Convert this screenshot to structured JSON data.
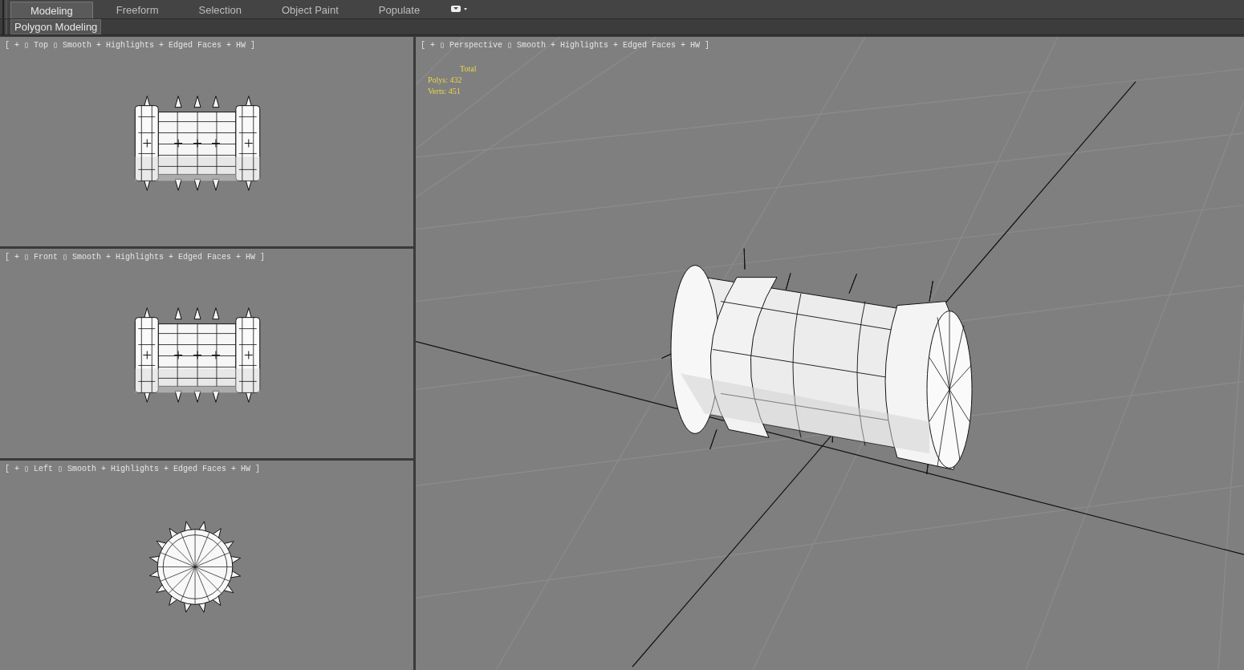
{
  "ribbon_tabs": [
    {
      "label": "Modeling",
      "selected": true
    },
    {
      "label": "Freeform",
      "selected": false
    },
    {
      "label": "Selection",
      "selected": false
    },
    {
      "label": "Object Paint",
      "selected": false
    },
    {
      "label": "Populate",
      "selected": false
    }
  ],
  "panel": {
    "label": "Polygon Modeling"
  },
  "viewports": [
    {
      "kind": "top",
      "label": "[ + ▯ Top ▯ Smooth + Highlights + Edged Faces + HW ]"
    },
    {
      "kind": "front",
      "label": "[ + ▯ Front ▯ Smooth + Highlights + Edged Faces + HW ]"
    },
    {
      "kind": "left",
      "label": "[ + ▯ Left ▯ Smooth + Highlights + Edged Faces + HW ]"
    },
    {
      "kind": "perspective",
      "label": "[ + ▯ Perspective ▯ Smooth + Highlights + Edged Faces + HW ]"
    }
  ],
  "stats": {
    "title": "Total",
    "lines": [
      "Polys: 432",
      "Verts: 451"
    ]
  }
}
